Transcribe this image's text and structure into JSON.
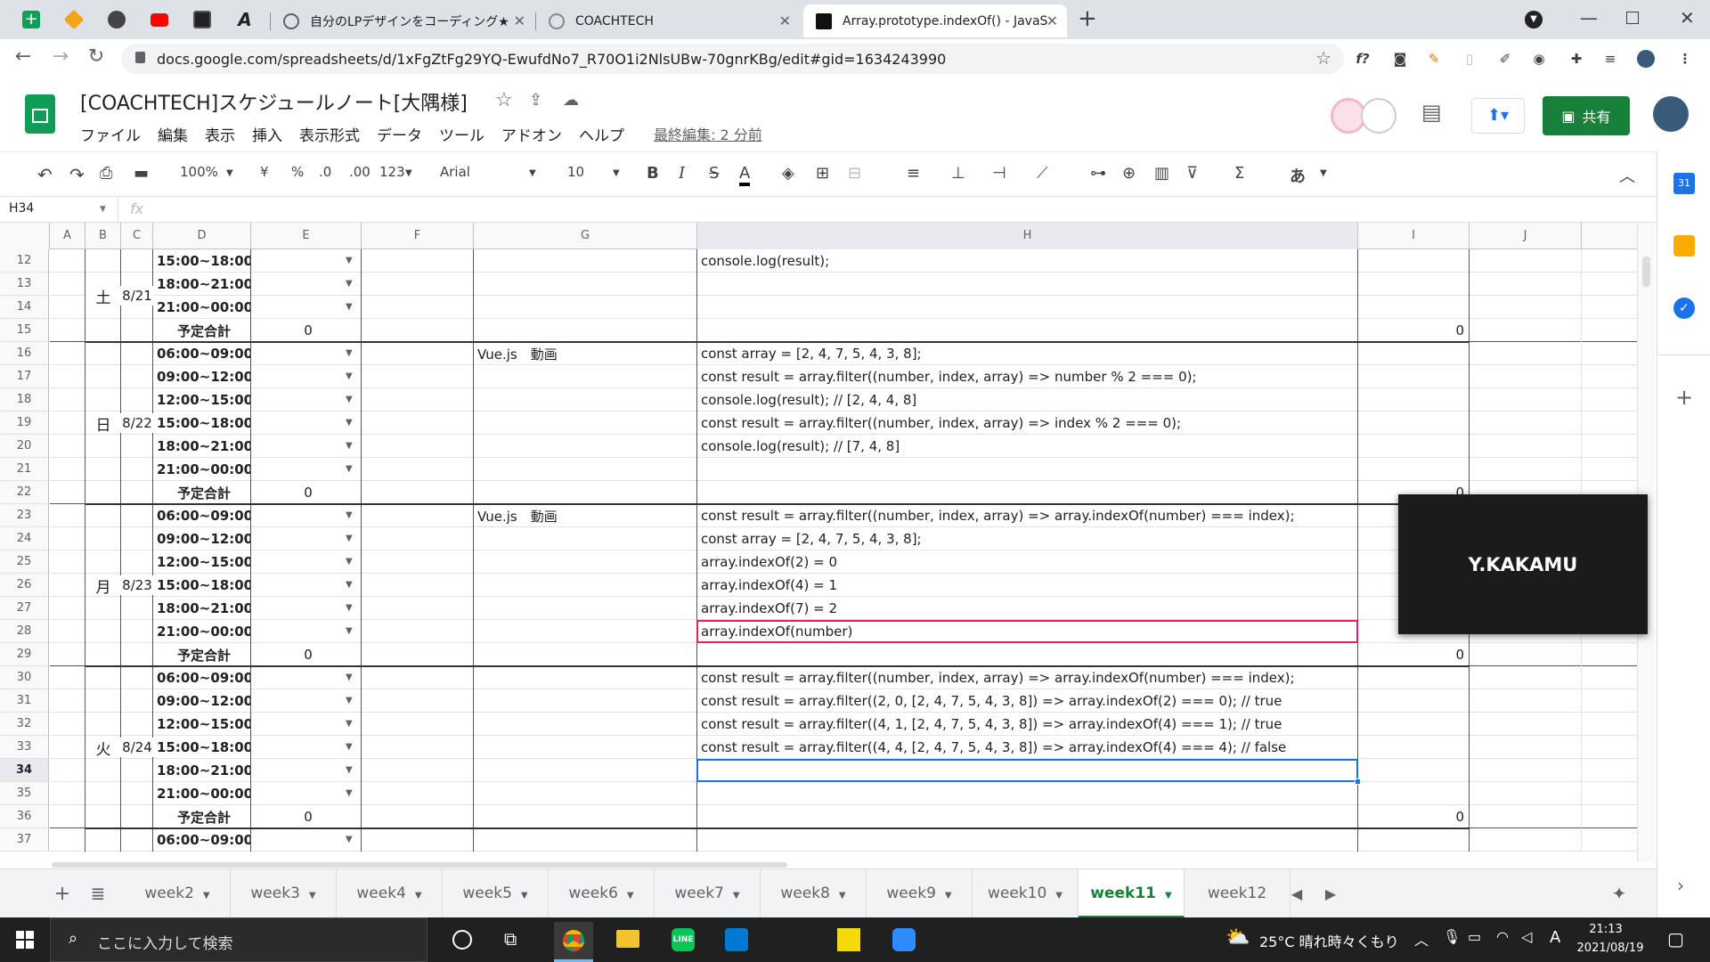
{
  "browser": {
    "tabs": [
      {
        "title": "自分のLPデザインをコーディング★"
      },
      {
        "title": "COACHTECH"
      },
      {
        "title": "Array.prototype.indexOf() - JavaS"
      }
    ],
    "url": "docs.google.com/spreadsheets/d/1xFgZtFg29YQ-EwufdNo7_R70O1i2NlsUBw-70gnrKBg/edit#gid=1634243990",
    "new_tab": "+"
  },
  "doc": {
    "title": "[COACHTECH]スケジュールノート[大隅様]",
    "menus": [
      "ファイル",
      "編集",
      "表示",
      "挿入",
      "表示形式",
      "データ",
      "ツール",
      "アドオン",
      "ヘルプ"
    ],
    "last_edit": "最終編集: 2 分前",
    "share": "共有"
  },
  "toolbar": {
    "zoom": "100%",
    "currency": "¥",
    "percent": "%",
    "dec_decrease": ".0",
    "dec_increase": ".00",
    "format_more": "123",
    "font": "Arial",
    "font_size": "10",
    "bold": "B",
    "italic": "I",
    "strike": "S",
    "text_color": "A",
    "input_tools": "あ"
  },
  "formula_bar": {
    "cell_ref": "H34",
    "fx": "fx",
    "value": ""
  },
  "columns": [
    "A",
    "B",
    "C",
    "D",
    "E",
    "F",
    "G",
    "H",
    "I",
    "J"
  ],
  "rows": [
    {
      "num": "12",
      "d": "15:00~18:00",
      "h": "console.log(result);"
    },
    {
      "num": "13",
      "d": "18:00~21:00"
    },
    {
      "num": "14",
      "d": "21:00~00:00"
    },
    {
      "num": "15",
      "d": "予定合計",
      "e": "0",
      "i": "0",
      "total": true
    },
    {
      "num": "16",
      "d": "06:00~09:00",
      "g": "Vue.js　動画",
      "h": "const array = [2, 4, 7, 5, 4, 3, 8];"
    },
    {
      "num": "17",
      "d": "09:00~12:00",
      "h": "const result = array.filter((number, index, array) => number % 2 === 0);"
    },
    {
      "num": "18",
      "d": "12:00~15:00",
      "h": "console.log(result); // [2, 4, 4, 8]"
    },
    {
      "num": "19",
      "d": "15:00~18:00",
      "h": "const result = array.filter((number, index, array) => index % 2 === 0);"
    },
    {
      "num": "20",
      "d": "18:00~21:00",
      "h": "console.log(result); // [7, 4, 8]"
    },
    {
      "num": "21",
      "d": "21:00~00:00"
    },
    {
      "num": "22",
      "d": "予定合計",
      "e": "0",
      "i": "0",
      "total": true
    },
    {
      "num": "23",
      "d": "06:00~09:00",
      "g": "Vue.js　動画",
      "h": "const result = array.filter((number, index, array) => array.indexOf(number)  === index);"
    },
    {
      "num": "24",
      "d": "09:00~12:00",
      "h": "const array = [2, 4, 7, 5, 4, 3, 8];"
    },
    {
      "num": "25",
      "d": "12:00~15:00",
      "h": "array.indexOf(2) = 0"
    },
    {
      "num": "26",
      "d": "15:00~18:00",
      "h": "array.indexOf(4) = 1"
    },
    {
      "num": "27",
      "d": "18:00~21:00",
      "h": "array.indexOf(7) = 2"
    },
    {
      "num": "28",
      "d": "21:00~00:00",
      "h": "array.indexOf(number)"
    },
    {
      "num": "29",
      "d": "予定合計",
      "e": "0",
      "i": "0",
      "total": true
    },
    {
      "num": "30",
      "d": "06:00~09:00",
      "h": "const result = array.filter((number, index, array) => array.indexOf(number)  === index);"
    },
    {
      "num": "31",
      "d": "09:00~12:00",
      "h": "const result = array.filter((2, 0,  [2, 4, 7, 5, 4, 3, 8]) => array.indexOf(2)  === 0); // true"
    },
    {
      "num": "32",
      "d": "12:00~15:00",
      "h": "const result = array.filter((4, 1,  [2, 4, 7, 5, 4, 3, 8]) => array.indexOf(4)  === 1); // true"
    },
    {
      "num": "33",
      "d": "15:00~18:00",
      "h": "const result = array.filter((4, 4,  [2, 4, 7, 5, 4, 3, 8]) => array.indexOf(4)  === 4); // false"
    },
    {
      "num": "34",
      "d": "18:00~21:00"
    },
    {
      "num": "35",
      "d": "21:00~00:00"
    },
    {
      "num": "36",
      "d": "予定合計",
      "e": "0",
      "i": "0",
      "total": true
    },
    {
      "num": "37",
      "d": "06:00~09:00"
    }
  ],
  "day_groups": [
    {
      "day": "土",
      "date": "8/21"
    },
    {
      "day": "日",
      "date": "8/22"
    },
    {
      "day": "月",
      "date": "8/23"
    },
    {
      "day": "火",
      "date": "8/24"
    }
  ],
  "sheets": [
    "week2",
    "week3",
    "week4",
    "week5",
    "week6",
    "week7",
    "week8",
    "week9",
    "week10",
    "week11",
    "week12"
  ],
  "active_sheet": "week11",
  "overlay_name": "Y.KAKAMU",
  "taskbar": {
    "search": "ここに入力して検索",
    "weather": "25°C  晴れ時々くもり",
    "ime": "A",
    "time": "21:13",
    "date": "2021/08/19"
  },
  "colors": {
    "share": "#188038",
    "selection": "#1a73e8",
    "pink_sel": "#e91e63",
    "sheets_green": "#0f9d58"
  }
}
